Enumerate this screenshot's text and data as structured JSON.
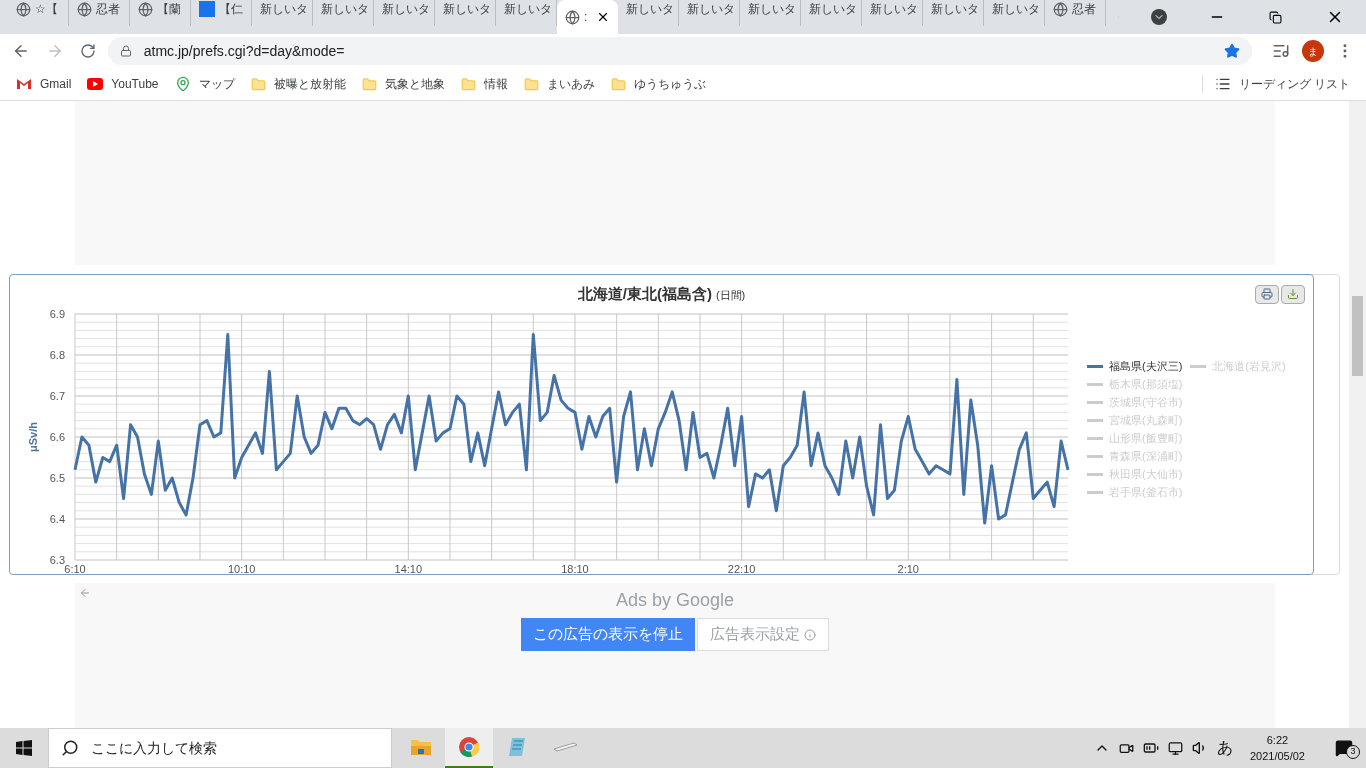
{
  "browser": {
    "tabs": [
      {
        "kind": "globe",
        "title": "☆【",
        "selected": false
      },
      {
        "kind": "globe",
        "title": "忍者",
        "selected": false
      },
      {
        "kind": "globe",
        "title": "【蘭",
        "selected": false
      },
      {
        "kind": "dn",
        "title": "【仁",
        "selected": false
      },
      {
        "kind": "plain",
        "title": "新しいタ",
        "selected": false
      },
      {
        "kind": "plain",
        "title": "新しいタ",
        "selected": false
      },
      {
        "kind": "plain",
        "title": "新しいタ",
        "selected": false
      },
      {
        "kind": "plain",
        "title": "新しいタ",
        "selected": false
      },
      {
        "kind": "plain",
        "title": "新しいタ",
        "selected": false
      },
      {
        "kind": "globe",
        "title": ":",
        "selected": true
      },
      {
        "kind": "plain",
        "title": "新しいタ",
        "selected": false
      },
      {
        "kind": "plain",
        "title": "新しいタ",
        "selected": false
      },
      {
        "kind": "plain",
        "title": "新しいタ",
        "selected": false
      },
      {
        "kind": "plain",
        "title": "新しいタ",
        "selected": false
      },
      {
        "kind": "plain",
        "title": "新しいタ",
        "selected": false
      },
      {
        "kind": "plain",
        "title": "新しいタ",
        "selected": false
      },
      {
        "kind": "plain",
        "title": "新しいタ",
        "selected": false
      },
      {
        "kind": "globe",
        "title": "忍者",
        "selected": false
      }
    ],
    "address": "atmc.jp/prefs.cgi?d=day&mode=",
    "profile": "ま",
    "bookmarks": [
      {
        "kind": "gmail",
        "label": "Gmail"
      },
      {
        "kind": "youtube",
        "label": "YouTube"
      },
      {
        "kind": "maps",
        "label": "マップ"
      },
      {
        "kind": "folder",
        "label": "被曝と放射能"
      },
      {
        "kind": "folder",
        "label": "気象と地象"
      },
      {
        "kind": "folder",
        "label": "情報"
      },
      {
        "kind": "folder",
        "label": "まいあみ"
      },
      {
        "kind": "folder",
        "label": "ゆうちゅうぶ"
      }
    ],
    "reading_list": "リーディング リスト"
  },
  "chart": {
    "title": "北海道/東北(福島含)",
    "subtitle": "(日間)",
    "other_series": [
      {
        "label": "北海道(岩見沢)",
        "visible": false
      },
      {
        "label": "栃木県(那須塩)",
        "visible": false
      },
      {
        "label": "茨城県(守谷市)",
        "visible": false
      },
      {
        "label": "宮城県(丸森町)",
        "visible": false
      },
      {
        "label": "山形県(飯豊町)",
        "visible": false
      },
      {
        "label": "青森県(深浦町)",
        "visible": false
      },
      {
        "label": "秋田県(大仙市)",
        "visible": false
      },
      {
        "label": "岩手県(釜石市)",
        "visible": false
      }
    ],
    "chart_data": {
      "type": "line",
      "ylabel": "μSv/h",
      "ylim": [
        6.3,
        6.9
      ],
      "yticks": [
        6.3,
        6.4,
        6.5,
        6.6,
        6.7,
        6.8,
        6.9
      ],
      "grid": true,
      "categories": [
        "6:10",
        null,
        null,
        null,
        null,
        null,
        null,
        null,
        null,
        null,
        null,
        null,
        null,
        null,
        null,
        null,
        null,
        null,
        null,
        null,
        null,
        null,
        null,
        null,
        "10:10",
        null,
        null,
        null,
        null,
        null,
        null,
        null,
        null,
        null,
        null,
        null,
        null,
        null,
        null,
        null,
        null,
        null,
        null,
        null,
        null,
        null,
        null,
        null,
        "14:10",
        null,
        null,
        null,
        null,
        null,
        null,
        null,
        null,
        null,
        null,
        null,
        null,
        null,
        null,
        null,
        null,
        null,
        null,
        null,
        null,
        null,
        null,
        null,
        "18:10",
        null,
        null,
        null,
        null,
        null,
        null,
        null,
        null,
        null,
        null,
        null,
        null,
        null,
        null,
        null,
        null,
        null,
        null,
        null,
        null,
        null,
        null,
        null,
        "22:10",
        null,
        null,
        null,
        null,
        null,
        null,
        null,
        null,
        null,
        null,
        null,
        null,
        null,
        null,
        null,
        null,
        null,
        null,
        null,
        null,
        null,
        null,
        null,
        "2:10",
        null,
        null,
        null,
        null,
        null,
        null,
        null,
        null,
        null,
        null,
        null,
        null,
        null,
        null,
        null,
        null,
        null,
        null,
        null,
        null,
        null,
        null,
        null
      ],
      "series": [
        {
          "name": "福島県(夫沢三)",
          "color": "#4572a7",
          "values": [
            6.52,
            6.6,
            6.58,
            6.49,
            6.55,
            6.54,
            6.58,
            6.45,
            6.63,
            6.6,
            6.51,
            6.46,
            6.59,
            6.47,
            6.5,
            6.44,
            6.41,
            6.5,
            6.63,
            6.64,
            6.6,
            6.61,
            6.85,
            6.5,
            6.55,
            6.58,
            6.61,
            6.56,
            6.76,
            6.52,
            6.54,
            6.56,
            6.7,
            6.6,
            6.56,
            6.58,
            6.66,
            6.62,
            6.67,
            6.67,
            6.64,
            6.63,
            6.645,
            6.63,
            6.57,
            6.63,
            6.655,
            6.61,
            6.7,
            6.52,
            6.61,
            6.7,
            6.59,
            6.61,
            6.62,
            6.7,
            6.68,
            6.54,
            6.61,
            6.53,
            6.62,
            6.71,
            6.63,
            6.66,
            6.68,
            6.52,
            6.85,
            6.64,
            6.66,
            6.75,
            6.69,
            6.67,
            6.66,
            6.57,
            6.65,
            6.6,
            6.65,
            6.67,
            6.49,
            6.65,
            6.71,
            6.52,
            6.62,
            6.53,
            6.62,
            6.66,
            6.71,
            6.64,
            6.52,
            6.66,
            6.55,
            6.56,
            6.5,
            6.58,
            6.67,
            6.53,
            6.65,
            6.43,
            6.51,
            6.5,
            6.52,
            6.42,
            6.53,
            6.55,
            6.58,
            6.71,
            6.53,
            6.61,
            6.53,
            6.5,
            6.46,
            6.59,
            6.5,
            6.6,
            6.48,
            6.41,
            6.63,
            6.45,
            6.47,
            6.59,
            6.65,
            6.57,
            6.54,
            6.51,
            6.53,
            6.52,
            6.51,
            6.74,
            6.46,
            6.69,
            6.58,
            6.39,
            6.53,
            6.4,
            6.41,
            6.49,
            6.57,
            6.61,
            6.45,
            6.47,
            6.49,
            6.43,
            6.59,
            6.52
          ]
        }
      ]
    }
  },
  "ad": {
    "attribution": "Ads by Google",
    "stop_button": "この広告の表示を停止",
    "settings_button": "広告表示設定"
  },
  "taskbar": {
    "search_placeholder": "ここに入力して検索",
    "apps": [
      {
        "kind": "explorer",
        "selected": false
      },
      {
        "kind": "chrome",
        "selected": true
      },
      {
        "kind": "notepad",
        "selected": false
      },
      {
        "kind": "device",
        "selected": false
      }
    ],
    "ime": "あ",
    "time": "6:22",
    "date": "2021/05/02",
    "notifications": "3"
  }
}
